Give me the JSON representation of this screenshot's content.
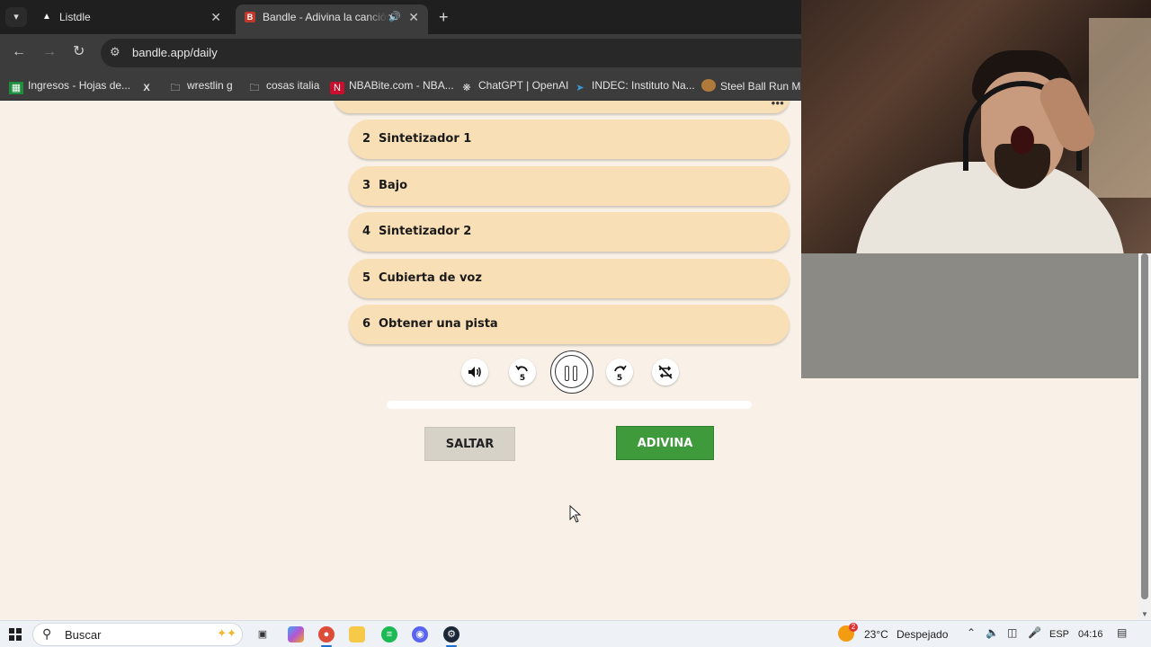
{
  "browser": {
    "tabs": [
      {
        "title": "Listdle",
        "active": false
      },
      {
        "title": "Bandle - Adivina la canción",
        "active": true,
        "audio": true
      }
    ],
    "url": "bandle.app/daily",
    "bookmarks": [
      {
        "label": "Ingresos - Hojas de...",
        "icon": "sheets-icon"
      },
      {
        "label": "",
        "icon": "x-icon"
      },
      {
        "label": "wrestlin g",
        "icon": "folder-icon"
      },
      {
        "label": "cosas italia",
        "icon": "folder-icon"
      },
      {
        "label": "NBABite.com - NBA...",
        "icon": "nba-icon"
      },
      {
        "label": "ChatGPT | OpenAI",
        "icon": "openai-icon"
      },
      {
        "label": "INDEC: Instituto Na...",
        "icon": "indec-icon"
      },
      {
        "label": "Steel Ball Run Man",
        "icon": "manga-icon"
      }
    ]
  },
  "game": {
    "tracks": [
      {
        "num": "2",
        "label": "Sintetizador 1"
      },
      {
        "num": "3",
        "label": "Bajo"
      },
      {
        "num": "4",
        "label": "Sintetizador 2"
      },
      {
        "num": "5",
        "label": "Cubierta de voz"
      },
      {
        "num": "6",
        "label": "Obtener una pista"
      }
    ],
    "controls": {
      "rewind_seconds": "5",
      "forward_seconds": "5",
      "state": "playing"
    },
    "progress": 0.0,
    "skip_label": "SALTAR",
    "guess_label": "ADIVINA",
    "colors": {
      "track_bg": "#f9dfb6",
      "guess_bg": "#3e9a3a",
      "skip_bg": "#d7d2c8",
      "page_bg": "#f9f1e7"
    }
  },
  "taskbar": {
    "search_placeholder": "Buscar",
    "weather_badge": "2",
    "temperature": "23°C",
    "weather": "Despejado",
    "language": "ESP",
    "time": "04:16"
  }
}
